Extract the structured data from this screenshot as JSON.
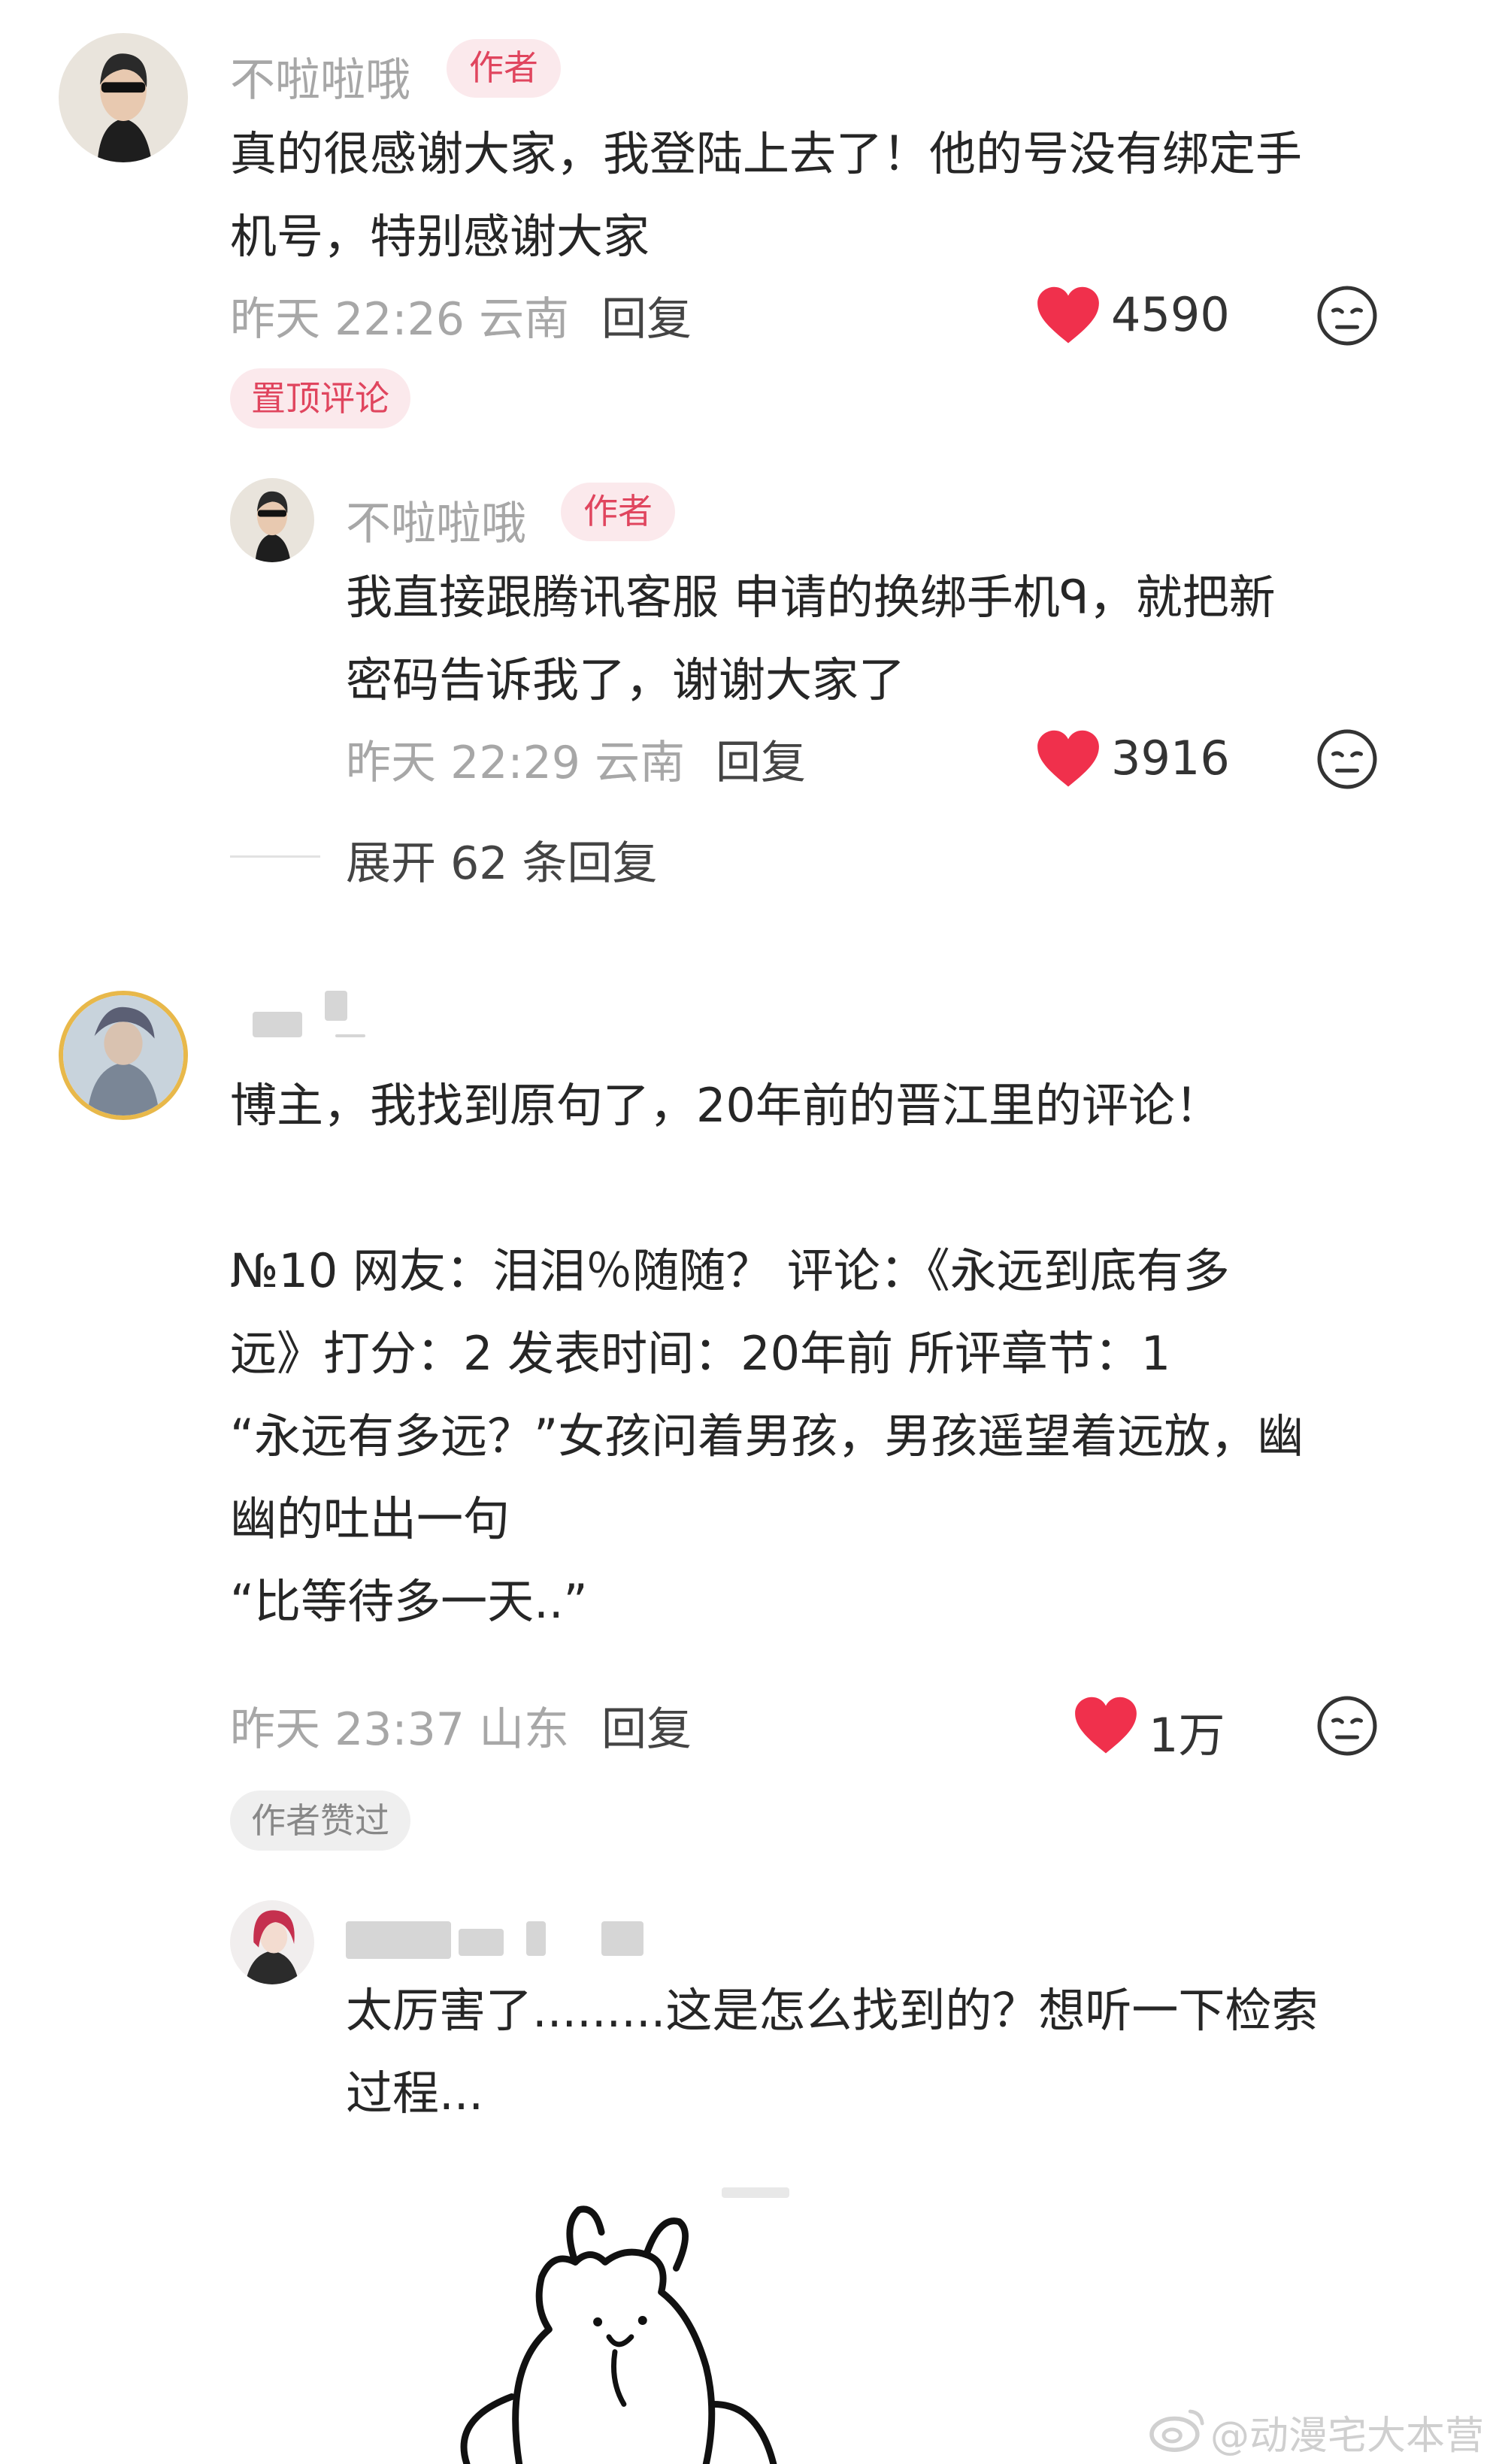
{
  "comments": [
    {
      "username": "不啦啦哦",
      "badge": "作者",
      "lines": [
        "真的很感谢大家，我登陆上去了！他的号没有绑定手",
        "机号，特别感谢大家"
      ],
      "time": "昨天 22:26",
      "location": "云南",
      "reply_label": "回复",
      "likes": "4590",
      "tag": "置顶评论"
    },
    {
      "username": "不啦啦哦",
      "badge": "作者",
      "lines": [
        "我直接跟腾讯客服 申请的换绑手机ᑫ，就把新",
        "密码告诉我了，谢谢大家了"
      ],
      "time": "昨天 22:29",
      "location": "云南",
      "reply_label": "回复",
      "likes": "3916"
    },
    {
      "username": "",
      "lines": [
        "博主，我找到原句了，20年前的晋江里的评论！",
        "",
        "№10 网友：泪泪％随随？  评论：《永远到底有多",
        "远》打分：2 发表时间：20年前 所评章节：1",
        "“永远有多远？”女孩问着男孩，男孩遥望着远放，幽",
        "幽的吐出一句",
        "“比等待多一天..”"
      ],
      "time": "昨天 23:37",
      "location": "山东",
      "reply_label": "回复",
      "likes": "1万",
      "tag": "作者赞过"
    },
    {
      "username": "",
      "lines": [
        "太厉害了.........这是怎么找到的？想听一下检索",
        "过程..."
      ]
    }
  ],
  "expand_replies": "展开 62 条回复",
  "watermark": "@动漫宅大本营",
  "colors": {
    "accent": "#e0455e",
    "heart": "#f0304c",
    "meta": "#a7a7a7"
  },
  "icons": [
    "heart-icon",
    "dislike-face-icon",
    "weibo-logo-icon"
  ]
}
